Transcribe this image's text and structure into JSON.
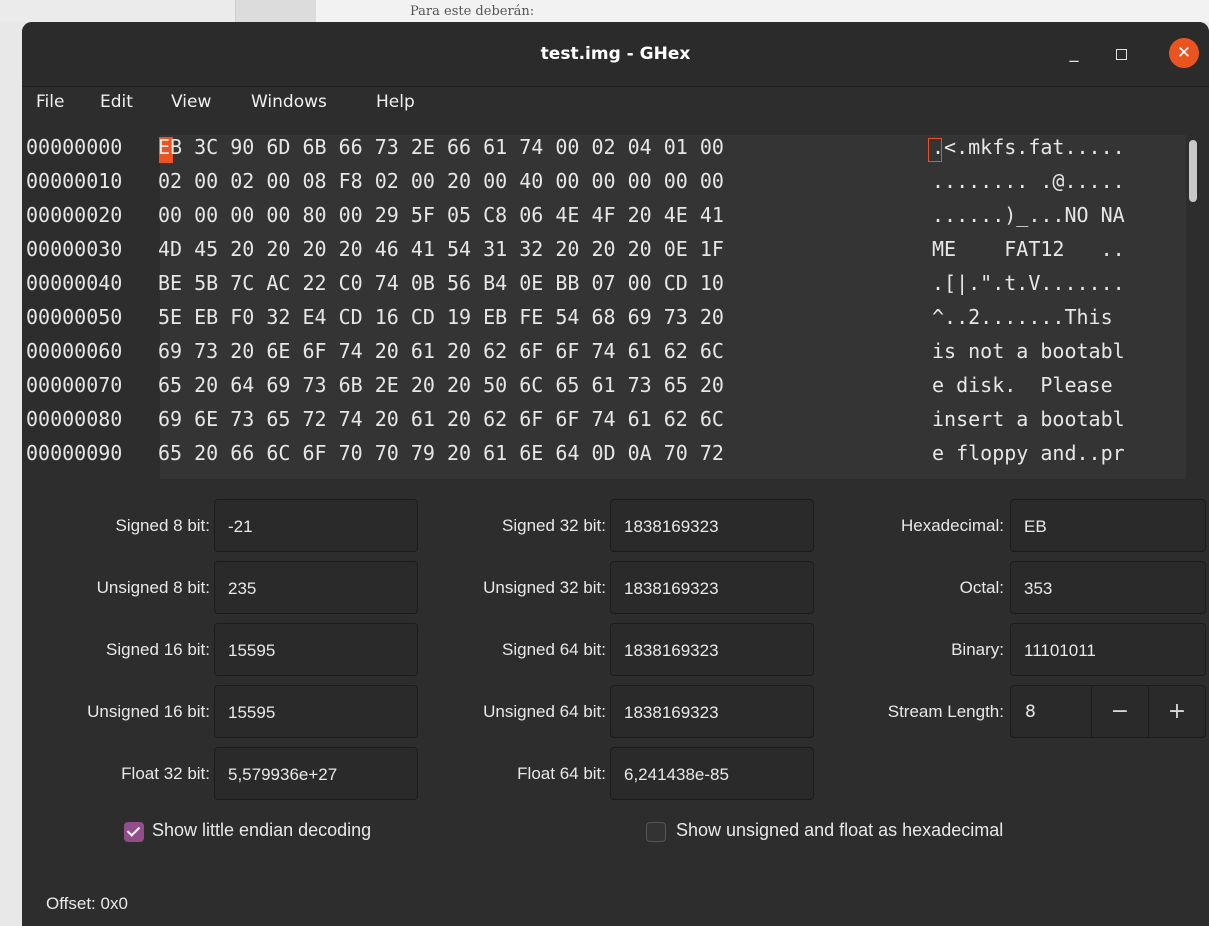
{
  "background": {
    "doc_text": "Para este deberán:"
  },
  "window": {
    "title": "test.img - GHex"
  },
  "colors": {
    "accent": "#e95420",
    "checkbox": "#924d8b",
    "window_bg": "#2d2d2d"
  },
  "icons": [
    "minimize-icon",
    "maximize-icon",
    "close-icon",
    "checkmark-icon"
  ],
  "menu": [
    "File",
    "Edit",
    "View",
    "Windows",
    "Help"
  ],
  "hex_rows": [
    {
      "offset": "00000000",
      "hex": "EB 3C 90 6D 6B 66 73 2E 66 61 74 00 02 04 01 00",
      "ascii": ".<.mkfs.fat....."
    },
    {
      "offset": "00000010",
      "hex": "02 00 02 00 08 F8 02 00 20 00 40 00 00 00 00 00",
      "ascii": "........ .@....."
    },
    {
      "offset": "00000020",
      "hex": "00 00 00 00 80 00 29 5F 05 C8 06 4E 4F 20 4E 41",
      "ascii": "......)_...NO NA"
    },
    {
      "offset": "00000030",
      "hex": "4D 45 20 20 20 20 46 41 54 31 32 20 20 20 0E 1F",
      "ascii": "ME    FAT12   .."
    },
    {
      "offset": "00000040",
      "hex": "BE 5B 7C AC 22 C0 74 0B 56 B4 0E BB 07 00 CD 10",
      "ascii": ".[|.\".t.V......."
    },
    {
      "offset": "00000050",
      "hex": "5E EB F0 32 E4 CD 16 CD 19 EB FE 54 68 69 73 20",
      "ascii": "^..2.......This "
    },
    {
      "offset": "00000060",
      "hex": "69 73 20 6E 6F 74 20 61 20 62 6F 6F 74 61 62 6C",
      "ascii": "is not a bootabl"
    },
    {
      "offset": "00000070",
      "hex": "65 20 64 69 73 6B 2E 20 20 50 6C 65 61 73 65 20",
      "ascii": "e disk.  Please "
    },
    {
      "offset": "00000080",
      "hex": "69 6E 73 65 72 74 20 61 20 62 6F 6F 74 61 62 6C",
      "ascii": "insert a bootabl"
    },
    {
      "offset": "00000090",
      "hex": "65 20 66 6C 6F 70 70 79 20 61 6E 64 0D 0A 70 72",
      "ascii": "e floppy and..pr"
    }
  ],
  "fields": {
    "signed8": {
      "label": "Signed 8 bit:",
      "value": "-21"
    },
    "unsigned8": {
      "label": "Unsigned 8 bit:",
      "value": "235"
    },
    "signed16": {
      "label": "Signed 16 bit:",
      "value": "15595"
    },
    "unsigned16": {
      "label": "Unsigned 16 bit:",
      "value": "15595"
    },
    "float32": {
      "label": "Float 32 bit:",
      "value": "5,579936e+27"
    },
    "signed32": {
      "label": "Signed 32 bit:",
      "value": "1838169323"
    },
    "unsigned32": {
      "label": "Unsigned 32 bit:",
      "value": "1838169323"
    },
    "signed64": {
      "label": "Signed 64 bit:",
      "value": "1838169323"
    },
    "unsigned64": {
      "label": "Unsigned 64 bit:",
      "value": "1838169323"
    },
    "float64": {
      "label": "Float 64 bit:",
      "value": "6,241438e-85"
    },
    "hexadecimal": {
      "label": "Hexadecimal:",
      "value": "EB"
    },
    "octal": {
      "label": "Octal:",
      "value": "353"
    },
    "binary": {
      "label": "Binary:",
      "value": "11101011"
    },
    "stream_length": {
      "label": "Stream Length:",
      "value": "8",
      "minus": "−",
      "plus": "+"
    }
  },
  "checkboxes": {
    "little_endian": {
      "label": "Show little endian decoding",
      "checked": true
    },
    "unsigned_hex": {
      "label": "Show unsigned and float as hexadecimal",
      "checked": false
    }
  },
  "status": {
    "offset": "Offset: 0x0"
  }
}
